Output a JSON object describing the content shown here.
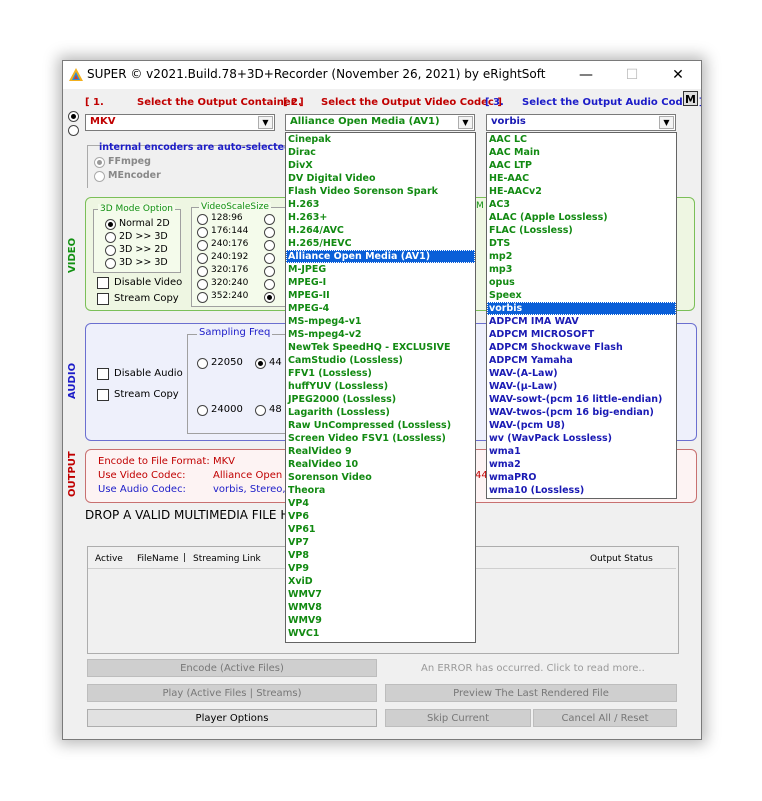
{
  "window": {
    "title": "SUPER © v2021.Build.78+3D+Recorder (November 26, 2021) by eRightSoft",
    "minimize": "—",
    "maximize": "☐",
    "close": "✕",
    "corner_label": "M"
  },
  "steps": {
    "container_num": "[ 1.",
    "container_label": "Select the Output Container ]",
    "video_num": "[ 2.",
    "video_label": "Select the Output Video Codec ]",
    "audio_num": "[ 3.",
    "audio_label": "Select the Output Audio Codec ]"
  },
  "selectors": {
    "container": "MKV",
    "video_codec": "Alliance Open Media (AV1)",
    "audio_codec": "vorbis"
  },
  "encoders": {
    "note": "internal encoders are auto-selected to",
    "option1": "FFmpeg",
    "option2": "MEncoder"
  },
  "video": {
    "section_label": "VIDEO",
    "mode_title": "3D Mode Option",
    "modes": [
      "Normal 2D",
      "2D >> 3D",
      "3D >> 2D",
      "3D >> 3D"
    ],
    "scale_title": "VideoScaleSize",
    "sizes": [
      "128:96",
      "176:144",
      "240:176",
      "240:192",
      "320:176",
      "320:240",
      "352:240"
    ],
    "disable_video": "Disable Video",
    "stream_copy": "Stream Copy"
  },
  "audio": {
    "section_label": "AUDIO",
    "disable_audio": "Disable Audio",
    "stream_copy": "Stream Copy",
    "sampling_title": "Sampling Freq",
    "freq_22050": "22050",
    "freq_441": "44",
    "freq_24000": "24000",
    "freq_480": "48"
  },
  "output": {
    "section_label": "OUTPUT",
    "format_label": "Encode to File Format:",
    "format_value": "MKV",
    "video_label": "Use Video Codec:",
    "video_value": "Alliance Open",
    "audio_label": "Use Audio Codec:",
    "audio_value": "vorbis,  Stereo,",
    "right_fragment_1": "M",
    "right_fragment_2": "44"
  },
  "drop_text": "DROP A VALID MULTIMEDIA FILE HE",
  "file_table": {
    "col_active": "Active",
    "col_filename": "FileName",
    "col_sep": "|",
    "col_streaming": "Streaming Link",
    "col_status": "Output Status"
  },
  "buttons": {
    "encode": "Encode (Active Files)",
    "error_msg": "An ERROR has occurred. Click to read more..",
    "play": "Play (Active Files | Streams)",
    "preview": "Preview The Last Rendered File",
    "player_options": "Player Options",
    "skip": "Skip Current",
    "cancel": "Cancel All   /   Reset"
  },
  "video_codec_list": [
    "Cinepak",
    "Dirac",
    "DivX",
    "DV Digital Video",
    "Flash Video Sorenson Spark",
    "H.263",
    "H.263+",
    "H.264/AVC",
    "H.265/HEVC",
    "Alliance Open Media (AV1)",
    "M-JPEG",
    "MPEG-I",
    "MPEG-II",
    "MPEG-4",
    "MS-mpeg4-v1",
    "MS-mpeg4-v2",
    "NewTek SpeedHQ - EXCLUSIVE",
    "CamStudio (Lossless)",
    "FFV1 (Lossless)",
    "huffYUV (Lossless)",
    "JPEG2000 (Lossless)",
    "Lagarith (Lossless)",
    "Raw UnCompressed (Lossless)",
    "Screen Video  FSV1 (Lossless)",
    "RealVideo 9",
    "RealVideo 10",
    "Sorenson Video",
    "Theora",
    "VP4",
    "VP6",
    "VP61",
    "VP7",
    "VP8",
    "VP9",
    "XviD",
    "WMV7",
    "WMV8",
    "WMV9",
    "WVC1"
  ],
  "video_codec_selected_index": 9,
  "audio_codec_list": [
    "AAC LC",
    "AAC Main",
    "AAC LTP",
    "HE-AAC",
    "HE-AACv2",
    "AC3",
    "ALAC (Apple Lossless)",
    "FLAC (Lossless)",
    "DTS",
    "mp2",
    "mp3",
    "opus",
    "Speex",
    "vorbis",
    "ADPCM IMA WAV",
    "ADPCM MICROSOFT",
    "ADPCM Shockwave Flash",
    "ADPCM Yamaha",
    "WAV-(A-Law)",
    "WAV-(μ-Law)",
    "WAV-sowt-(pcm 16 little-endian)",
    "WAV-twos-(pcm 16 big-endian)",
    "WAV-(pcm U8)",
    "wv (WavPack Lossless)",
    "wma1",
    "wma2",
    "wmaPRO",
    "wma10 (Lossless)"
  ],
  "audio_codec_selected_index": 13,
  "audio_codec_green_until": 13,
  "colors": {
    "accent_red": "#c00000",
    "accent_blue": "#1c1cc8",
    "list_green": "#128a12",
    "list_blue": "#1a1ab4",
    "selection": "#0a5fd8"
  }
}
